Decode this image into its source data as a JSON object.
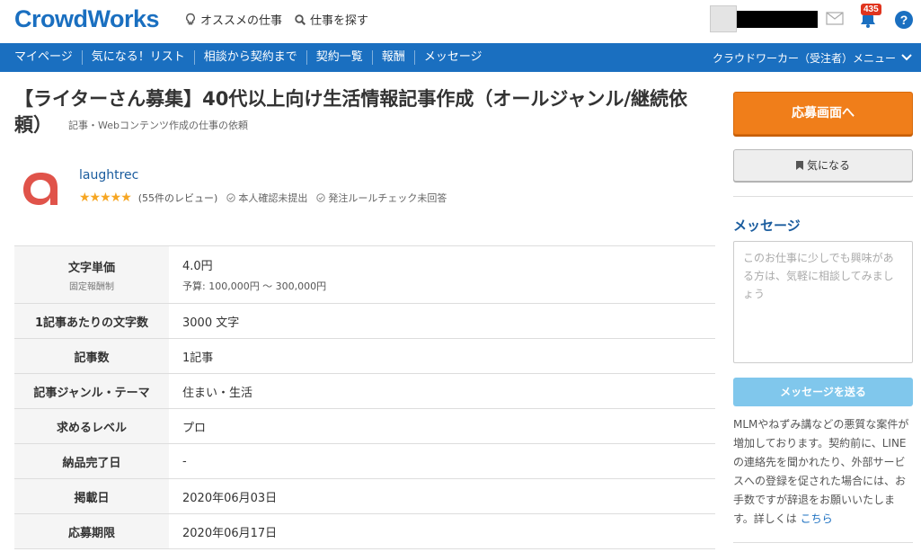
{
  "header": {
    "logo": "CrowdWorks",
    "links": [
      {
        "label": "オススメの仕事",
        "icon": "bulb-icon"
      },
      {
        "label": "仕事を探す",
        "icon": "search-icon"
      }
    ],
    "notification_count": "435"
  },
  "nav": {
    "items": [
      "マイページ",
      "気になる！リスト",
      "相談から契約まで",
      "契約一覧",
      "報酬",
      "メッセージ"
    ],
    "menu_label": "クラウドワーカー（受注者）メニュー"
  },
  "job": {
    "title": "【ライターさん募集】40代以上向け生活情報記事作成（オールジャンル/継続依頼）",
    "category": "記事・Webコンテンツ作成の仕事の依頼"
  },
  "client": {
    "name": "laughtrec",
    "rating": 4.5,
    "review_count": "(55件のレビュー)",
    "identity_status": "本人確認未提出",
    "rule_check_status": "発注ルールチェック未回答",
    "logo_color": "#e0534a"
  },
  "details": {
    "unit_price_label": "文字単価",
    "unit_price_sub": "固定報酬制",
    "unit_price_value": "4.0円",
    "budget": "予算: 100,000円 〜 300,000円",
    "rows": [
      {
        "label": "1記事あたりの文字数",
        "value": "3000 文字"
      },
      {
        "label": "記事数",
        "value": "1記事"
      },
      {
        "label": "記事ジャンル・テーマ",
        "value": "住まい・生活"
      },
      {
        "label": "求めるレベル",
        "value": "プロ"
      },
      {
        "label": "納品完了日",
        "value": "-"
      },
      {
        "label": "掲載日",
        "value": "2020年06月03日"
      },
      {
        "label": "応募期限",
        "value": "2020年06月17日"
      }
    ]
  },
  "sidebar": {
    "apply_label": "応募画面へ",
    "favorite_label": "気になる",
    "message_heading": "メッセージ",
    "message_placeholder": "このお仕事に少しでも興味がある方は、気軽に相談してみましょう",
    "send_label": "メッセージを送る",
    "warning_text": "MLMやねずみ講などの悪質な案件が増加しております。契約前に、LINEの連絡先を聞かれたり、外部サービスへの登録を促された場合には、お手数ですが辞退をお願いいたします。詳しくは",
    "warning_link": "こちら"
  },
  "colors": {
    "brand_blue": "#1a6fc0",
    "apply_orange": "#f07e1a",
    "send_disabled": "#80c7ec",
    "badge_red": "#e0341e",
    "star_gold": "#f6a623"
  }
}
